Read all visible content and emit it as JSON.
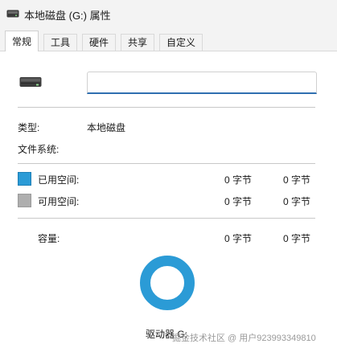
{
  "window": {
    "title": "本地磁盘 (G:) 属性"
  },
  "tabs": [
    {
      "label": "常规",
      "active": true
    },
    {
      "label": "工具",
      "active": false
    },
    {
      "label": "硬件",
      "active": false
    },
    {
      "label": "共享",
      "active": false
    },
    {
      "label": "自定义",
      "active": false
    }
  ],
  "general": {
    "name_value": "",
    "type_label": "类型:",
    "type_value": "本地磁盘",
    "fs_label": "文件系统:",
    "fs_value": "",
    "used_label": "已用空间:",
    "used_bytes": "0 字节",
    "used_size": "0 字节",
    "free_label": "可用空间:",
    "free_bytes": "0 字节",
    "free_size": "0 字节",
    "capacity_label": "容量:",
    "capacity_bytes": "0 字节",
    "capacity_size": "0 字节",
    "drive_label": "驱动器 G:"
  },
  "colors": {
    "used": "#2b9bd6",
    "free": "#aeaeae",
    "accent": "#2f6fb0"
  },
  "icons": {
    "title": "drive-icon",
    "drive": "hard-drive-icon"
  },
  "watermark": "掘金技术社区 @ 用户923993349810"
}
